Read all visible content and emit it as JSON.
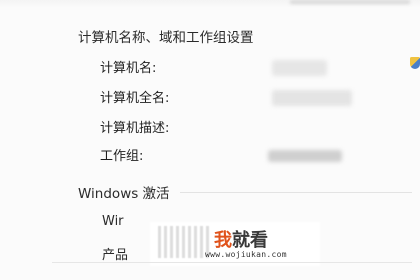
{
  "computer_name_section": {
    "title": "计算机名称、域和工作组设置",
    "rows": [
      {
        "label": "计算机名:"
      },
      {
        "label": "计算机全名:"
      },
      {
        "label": "计算机描述:"
      },
      {
        "label": "工作组:"
      }
    ]
  },
  "activation_section": {
    "title": "Windows 激活",
    "row1_partial": "Wir",
    "row2_partial": "产品"
  },
  "watermark": {
    "brand_first": "我",
    "brand_rest": "就看",
    "url": "www.wojiukan.com"
  },
  "icons": {
    "change_settings": "shield-icon"
  }
}
